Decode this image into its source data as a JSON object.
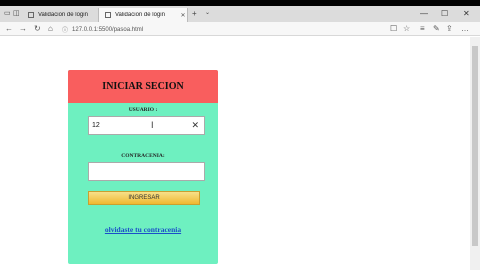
{
  "browser": {
    "tabs": [
      {
        "title": "Validacion de login",
        "active": false
      },
      {
        "title": "Validacion de login",
        "active": true
      }
    ],
    "new_tab_icon": "+",
    "tab_menu_icon": "⌄",
    "window_controls": [
      "—",
      "☐",
      "✕"
    ],
    "nav_icons": {
      "back": "←",
      "forward": "→",
      "refresh": "↻",
      "home": "⌂"
    },
    "url": "127.0.0.1:5500/pasoa.html",
    "right_icons": {
      "reading": "☐",
      "favorite": "☆",
      "hub": "≡",
      "pen": "✎",
      "share": "⇪",
      "more": "…"
    }
  },
  "login": {
    "title": "INICIAR SECION",
    "user_label": "USUARIO :",
    "user_value": "12",
    "password_label": "CONTRACENIA:",
    "password_value": "",
    "submit_label": "INGRESAR",
    "forgot_link": "olvidaste tu contracenia"
  },
  "colors": {
    "card_bg": "#6ef0c0",
    "header_bg": "#f95e5e",
    "button_top": "#f7e08a",
    "button_bottom": "#f0b830",
    "link": "#1b4fc9"
  }
}
